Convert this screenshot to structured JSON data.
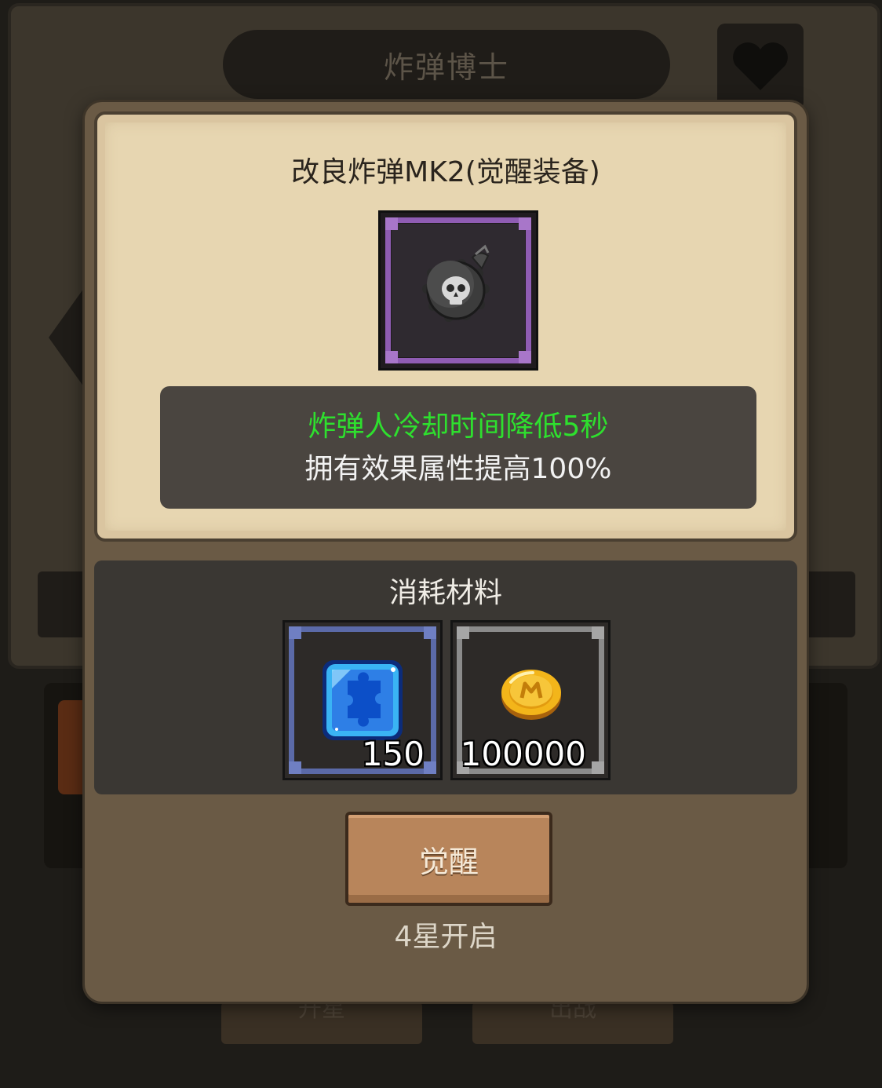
{
  "background": {
    "hero_name": "炸弹博士",
    "favorite_icon": "heart-icon",
    "bottom_buttons": [
      "升星",
      "出战"
    ]
  },
  "modal": {
    "item_title": "改良炸弹MK2(觉醒装备)",
    "item_icon": "skull-bomb-icon",
    "item_rarity_color": "#8f5cb3",
    "effects": {
      "primary": "炸弹人冷却时间降低5秒",
      "primary_color": "#2ee02e",
      "secondary": "拥有效果属性提高100%"
    },
    "materials": {
      "label": "消耗材料",
      "items": [
        {
          "icon": "blue-puzzle-shard-icon",
          "quantity": "150",
          "frame_color": "#5b6aa8"
        },
        {
          "icon": "gold-coin-icon",
          "quantity": "100000",
          "frame_color": "#8b8b8b"
        }
      ]
    },
    "awaken_button": "觉醒",
    "unlock_requirement": "4星开启"
  }
}
